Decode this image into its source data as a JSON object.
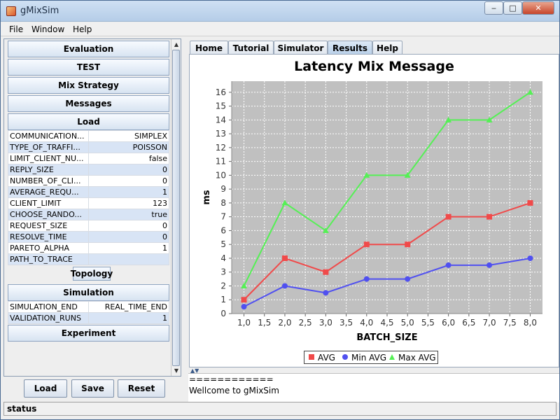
{
  "window": {
    "title": "gMixSim",
    "minimize": "‒",
    "maximize": "□",
    "close": "✕"
  },
  "menu": [
    "File",
    "Window",
    "Help"
  ],
  "left": {
    "sections_top": [
      "Evaluation",
      "TEST",
      "Mix Strategy",
      "Messages",
      "Load"
    ],
    "load_props": [
      {
        "key": "COMMUNICATION...",
        "value": "SIMPLEX"
      },
      {
        "key": "TYPE_OF_TRAFFI...",
        "value": "POISSON"
      },
      {
        "key": "LIMIT_CLIENT_NU...",
        "value": "false"
      },
      {
        "key": "REPLY_SIZE",
        "value": "0"
      },
      {
        "key": "NUMBER_OF_CLI...",
        "value": "0"
      },
      {
        "key": "AVERAGE_REQU...",
        "value": "1"
      },
      {
        "key": "CLIENT_LIMIT",
        "value": "123"
      },
      {
        "key": "CHOOSE_RANDO...",
        "value": "true"
      },
      {
        "key": "REQUEST_SIZE",
        "value": "0"
      },
      {
        "key": "RESOLVE_TIME",
        "value": "0"
      },
      {
        "key": "PARETO_ALPHA",
        "value": "1"
      },
      {
        "key": "PATH_TO_TRACE",
        "value": ""
      }
    ],
    "topology": "Topology",
    "simulation": "Simulation",
    "sim_props": [
      {
        "key": "SIMULATION_END",
        "value": "REAL_TIME_END"
      },
      {
        "key": "VALIDATION_RUNS",
        "value": "1"
      }
    ],
    "experiment": "Experiment",
    "buttons": {
      "load": "Load",
      "save": "Save",
      "reset": "Reset"
    }
  },
  "tabs": [
    "Home",
    "Tutorial",
    "Simulator",
    "Results",
    "Help"
  ],
  "active_tab": "Results",
  "console": {
    "lines": [
      "============",
      "Wellcome to gMixSim"
    ]
  },
  "status": "status",
  "colors": {
    "avg": "#f04a4a",
    "min": "#5050f0",
    "max": "#55f055",
    "plot_bg": "#c0c0c0"
  },
  "chart_data": {
    "type": "line",
    "title": "Latency Mix Message",
    "xlabel": "BATCH_SIZE",
    "ylabel": "ms",
    "x": [
      1,
      2,
      3,
      4,
      5,
      6,
      7,
      8
    ],
    "xticks": [
      "1,0",
      "1,5",
      "2,0",
      "2,5",
      "3,0",
      "3,5",
      "4,0",
      "4,5",
      "5,0",
      "5,5",
      "6,0",
      "6,5",
      "7,0",
      "7,5",
      "8,0"
    ],
    "xlim": [
      0.7,
      8.3
    ],
    "ylim": [
      0,
      16.8
    ],
    "grid": true,
    "legend_position": "bottom",
    "series": [
      {
        "name": "AVG",
        "marker": "square",
        "values": [
          1,
          4,
          3,
          5,
          5,
          7,
          7,
          8
        ]
      },
      {
        "name": "Min AVG",
        "marker": "circle",
        "values": [
          0.5,
          2,
          1.5,
          2.5,
          2.5,
          3.5,
          3.5,
          4
        ]
      },
      {
        "name": "Max AVG",
        "marker": "triangle",
        "values": [
          2,
          8,
          6,
          10,
          10,
          14,
          14,
          16
        ]
      }
    ]
  }
}
